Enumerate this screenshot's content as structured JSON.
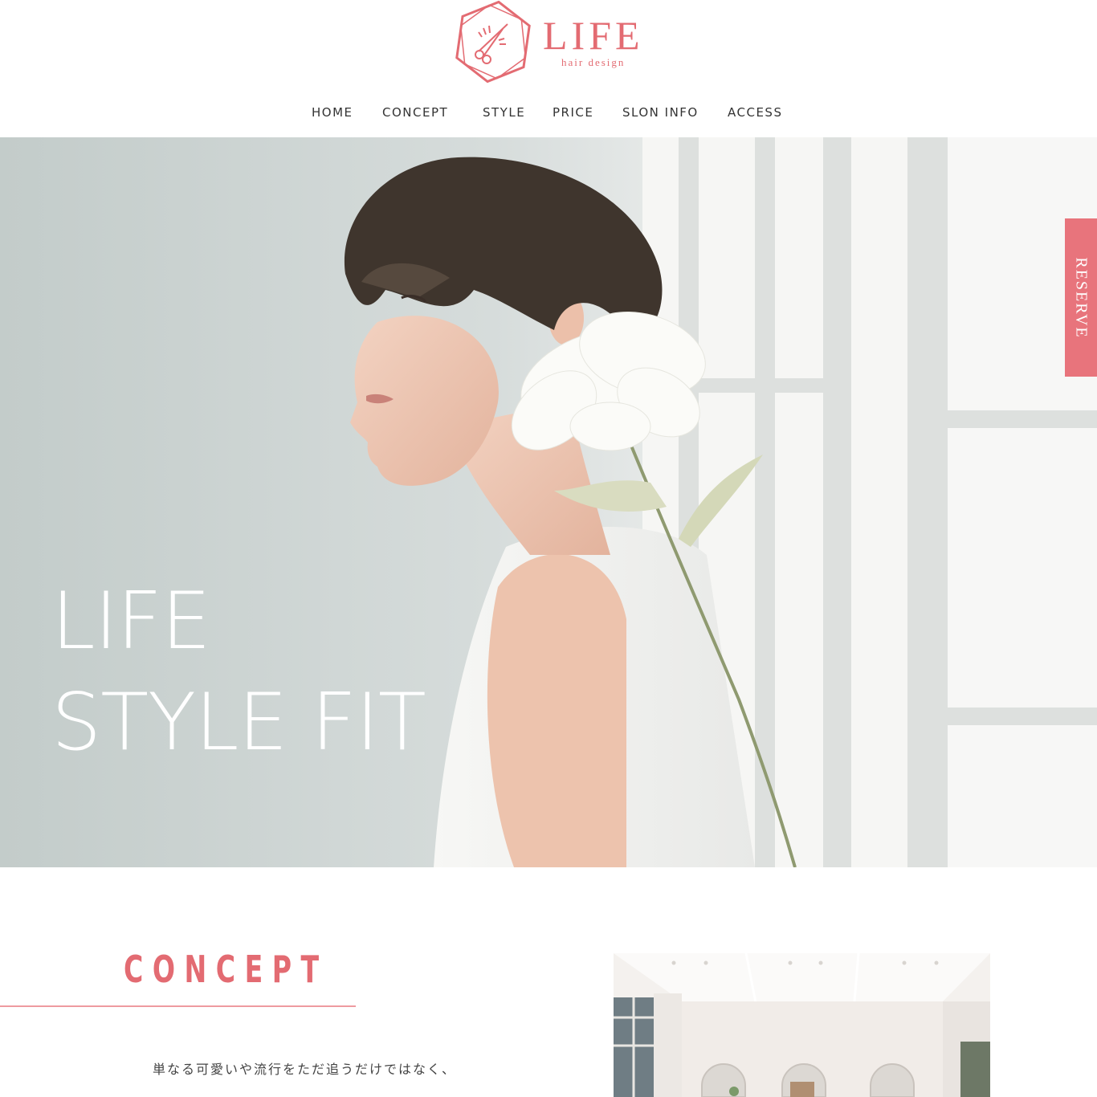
{
  "brand": {
    "name": "LIFE",
    "tagline": "hair design",
    "color": "#e36b72",
    "icon": "scissors-hexagon-icon"
  },
  "nav": {
    "items": [
      {
        "label": "HOME"
      },
      {
        "label": "CONCEPT"
      },
      {
        "label": "STYLE"
      },
      {
        "label": "PRICE"
      },
      {
        "label": "SLON INFO"
      },
      {
        "label": "ACCESS"
      }
    ]
  },
  "hero": {
    "line1": "LIFE",
    "line2": "STYLE FIT",
    "image": "woman-with-white-flower-photo"
  },
  "reserve_tab": {
    "label": "RESERVE",
    "color": "#e8747c"
  },
  "concept": {
    "heading": "CONCEPT",
    "text": "単なる可愛いや流行をただ追うだけではなく、",
    "image": "salon-interior-photo"
  }
}
